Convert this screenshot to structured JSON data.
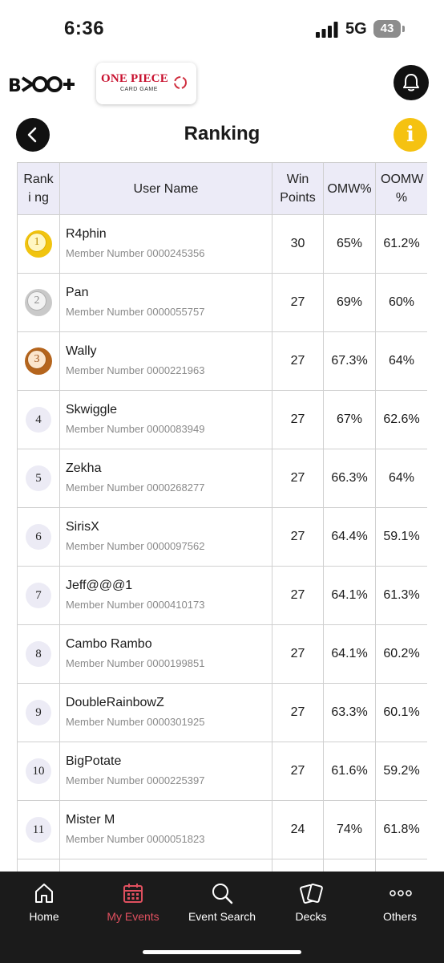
{
  "status_bar": {
    "time": "6:36",
    "network": "5G",
    "battery": "43"
  },
  "header": {
    "app_logo": "BCG+",
    "game_logo_title": "ONE PIECE",
    "game_logo_sub": "CARD GAME",
    "title": "Ranking"
  },
  "icons": {
    "bell": "bell-icon",
    "back": "chevron-left-icon",
    "info": "info-icon"
  },
  "info_glyph": "i",
  "table": {
    "headers": {
      "rank": "Ranki ng",
      "user": "User Name",
      "win": "Win Points",
      "omw": "OMW%",
      "oomw": "OOMW %"
    },
    "rows": [
      {
        "rank": "1",
        "name": "R4phin",
        "member": "Member Number 0000245356",
        "win": "30",
        "omw": "65%",
        "oomw": "61.2%"
      },
      {
        "rank": "2",
        "name": "Pan",
        "member": "Member Number 0000055757",
        "win": "27",
        "omw": "69%",
        "oomw": "60%"
      },
      {
        "rank": "3",
        "name": "Wally",
        "member": "Member Number 0000221963",
        "win": "27",
        "omw": "67.3%",
        "oomw": "64%"
      },
      {
        "rank": "4",
        "name": "Skwiggle",
        "member": "Member Number 0000083949",
        "win": "27",
        "omw": "67%",
        "oomw": "62.6%"
      },
      {
        "rank": "5",
        "name": "Zekha",
        "member": "Member Number 0000268277",
        "win": "27",
        "omw": "66.3%",
        "oomw": "64%"
      },
      {
        "rank": "6",
        "name": "SirisX",
        "member": "Member Number 0000097562",
        "win": "27",
        "omw": "64.4%",
        "oomw": "59.1%"
      },
      {
        "rank": "7",
        "name": "Jeff@@@1",
        "member": "Member Number 0000410173",
        "win": "27",
        "omw": "64.1%",
        "oomw": "61.3%"
      },
      {
        "rank": "8",
        "name": "Cambo Rambo",
        "member": "Member Number 0000199851",
        "win": "27",
        "omw": "64.1%",
        "oomw": "60.2%"
      },
      {
        "rank": "9",
        "name": "DoubleRainbowZ",
        "member": "Member Number 0000301925",
        "win": "27",
        "omw": "63.3%",
        "oomw": "60.1%"
      },
      {
        "rank": "10",
        "name": "BigPotate",
        "member": "Member Number 0000225397",
        "win": "27",
        "omw": "61.6%",
        "oomw": "59.2%"
      },
      {
        "rank": "11",
        "name": "Mister M",
        "member": "Member Number 0000051823",
        "win": "24",
        "omw": "74%",
        "oomw": "61.8%"
      }
    ]
  },
  "tabbar": {
    "tabs": [
      {
        "label": "Home",
        "icon": "home-icon",
        "active": false
      },
      {
        "label": "My Events",
        "icon": "calendar-icon",
        "active": true
      },
      {
        "label": "Event Search",
        "icon": "search-icon",
        "active": false
      },
      {
        "label": "Decks",
        "icon": "cards-icon",
        "active": false
      },
      {
        "label": "Others",
        "icon": "more-icon",
        "active": false
      }
    ]
  },
  "colors": {
    "accent_active_tab": "#e0505f",
    "info_yellow": "#f5c211",
    "header_row_bg": "#ecebf7",
    "tabbar_bg": "#1b1b1b"
  }
}
